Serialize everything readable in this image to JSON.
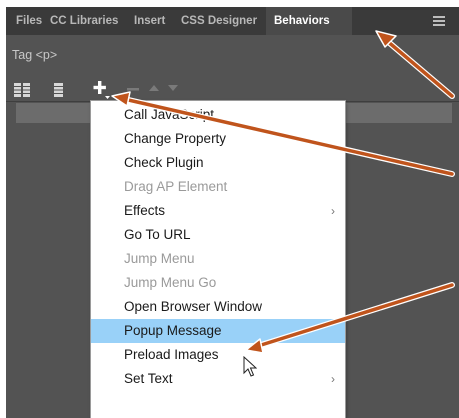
{
  "tabs": [
    {
      "label": "Files",
      "active": false
    },
    {
      "label": "CC Libraries",
      "active": false
    },
    {
      "label": "Insert",
      "active": false
    },
    {
      "label": "CSS Designer",
      "active": false
    },
    {
      "label": "Behaviors",
      "active": true
    }
  ],
  "tag_label": "Tag <p>",
  "toolbar": {
    "icons": [
      "show-set-events-icon",
      "show-all-events-icon",
      "add-behavior-icon",
      "remove-behavior-icon",
      "move-up-icon",
      "move-down-icon"
    ]
  },
  "menu": {
    "items": [
      {
        "label": "Call JavaScript",
        "disabled": false,
        "submenu": false,
        "selected": false
      },
      {
        "label": "Change Property",
        "disabled": false,
        "submenu": false,
        "selected": false
      },
      {
        "label": "Check Plugin",
        "disabled": false,
        "submenu": false,
        "selected": false
      },
      {
        "label": "Drag AP Element",
        "disabled": true,
        "submenu": false,
        "selected": false
      },
      {
        "label": "Effects",
        "disabled": false,
        "submenu": true,
        "selected": false
      },
      {
        "label": "Go To URL",
        "disabled": false,
        "submenu": false,
        "selected": false
      },
      {
        "label": "Jump Menu",
        "disabled": true,
        "submenu": false,
        "selected": false
      },
      {
        "label": "Jump Menu Go",
        "disabled": true,
        "submenu": false,
        "selected": false
      },
      {
        "label": "Open Browser Window",
        "disabled": false,
        "submenu": false,
        "selected": false
      },
      {
        "label": "Popup Message",
        "disabled": false,
        "submenu": false,
        "selected": true
      },
      {
        "label": "Preload Images",
        "disabled": false,
        "submenu": false,
        "selected": false
      },
      {
        "label": "Set Text",
        "disabled": false,
        "submenu": true,
        "selected": false
      }
    ],
    "submenu_glyph": "›"
  },
  "colors": {
    "panel_bg": "#535353",
    "tabbar_bg": "#3a3a3a",
    "active_tab_bg": "#4a4a4a",
    "menu_selected": "#99d1f8",
    "annotation_arrow": "#c0541c"
  }
}
